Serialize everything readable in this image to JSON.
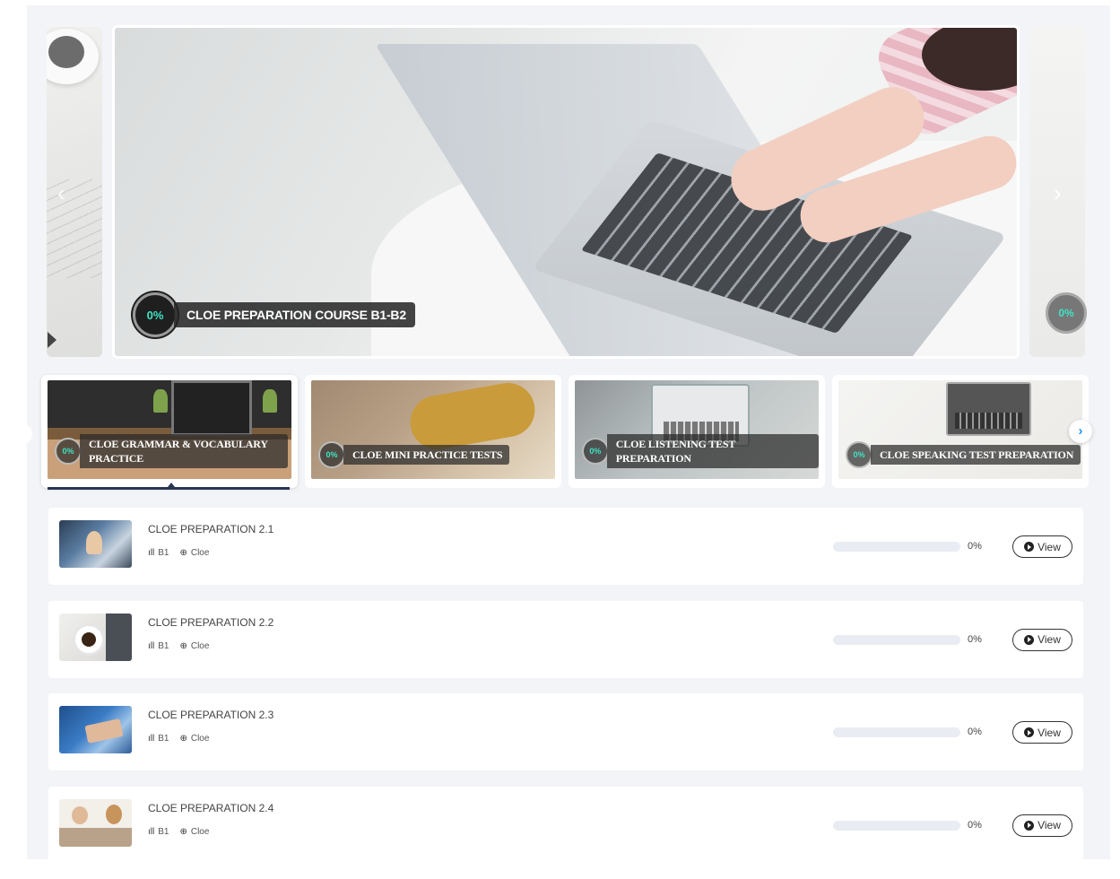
{
  "hero": {
    "title": "CLOE PREPARATION COURSE B1-B2",
    "progress": "0%",
    "next_progress": "0%",
    "prev_arrow": "‹",
    "next_arrow": "›"
  },
  "tabs": [
    {
      "label": "CLOE GRAMMAR & VOCABULARY PRACTICE",
      "progress": "0%",
      "active": true
    },
    {
      "label": "CLOE MINI PRACTICE TESTS",
      "progress": "0%",
      "active": false
    },
    {
      "label": "CLOE LISTENING TEST PREPARATION",
      "progress": "0%",
      "active": false
    },
    {
      "label": "CLOE SPEAKING TEST PREPARATION",
      "progress": "0%",
      "active": false
    }
  ],
  "tabs_next_arrow": "›",
  "lessons": [
    {
      "title": "CLOE PREPARATION 2.1",
      "level": "B1",
      "tag": "Cloe",
      "progress_value": 0,
      "progress_text": "0%",
      "action": "View"
    },
    {
      "title": "CLOE PREPARATION 2.2",
      "level": "B1",
      "tag": "Cloe",
      "progress_value": 0,
      "progress_text": "0%",
      "action": "View"
    },
    {
      "title": "CLOE PREPARATION 2.3",
      "level": "B1",
      "tag": "Cloe",
      "progress_value": 0,
      "progress_text": "0%",
      "action": "View"
    },
    {
      "title": "CLOE PREPARATION 2.4",
      "level": "B1",
      "tag": "Cloe",
      "progress_value": 0,
      "progress_text": "0%",
      "action": "View"
    }
  ],
  "icons": {
    "level": "signal-bars-icon",
    "tag": "crosshair-icon",
    "view": "play-circle-icon"
  },
  "colors": {
    "progress_accent": "#3fe3c4",
    "active_tab_underline": "#2a3550",
    "next_button": "#2196f3"
  }
}
